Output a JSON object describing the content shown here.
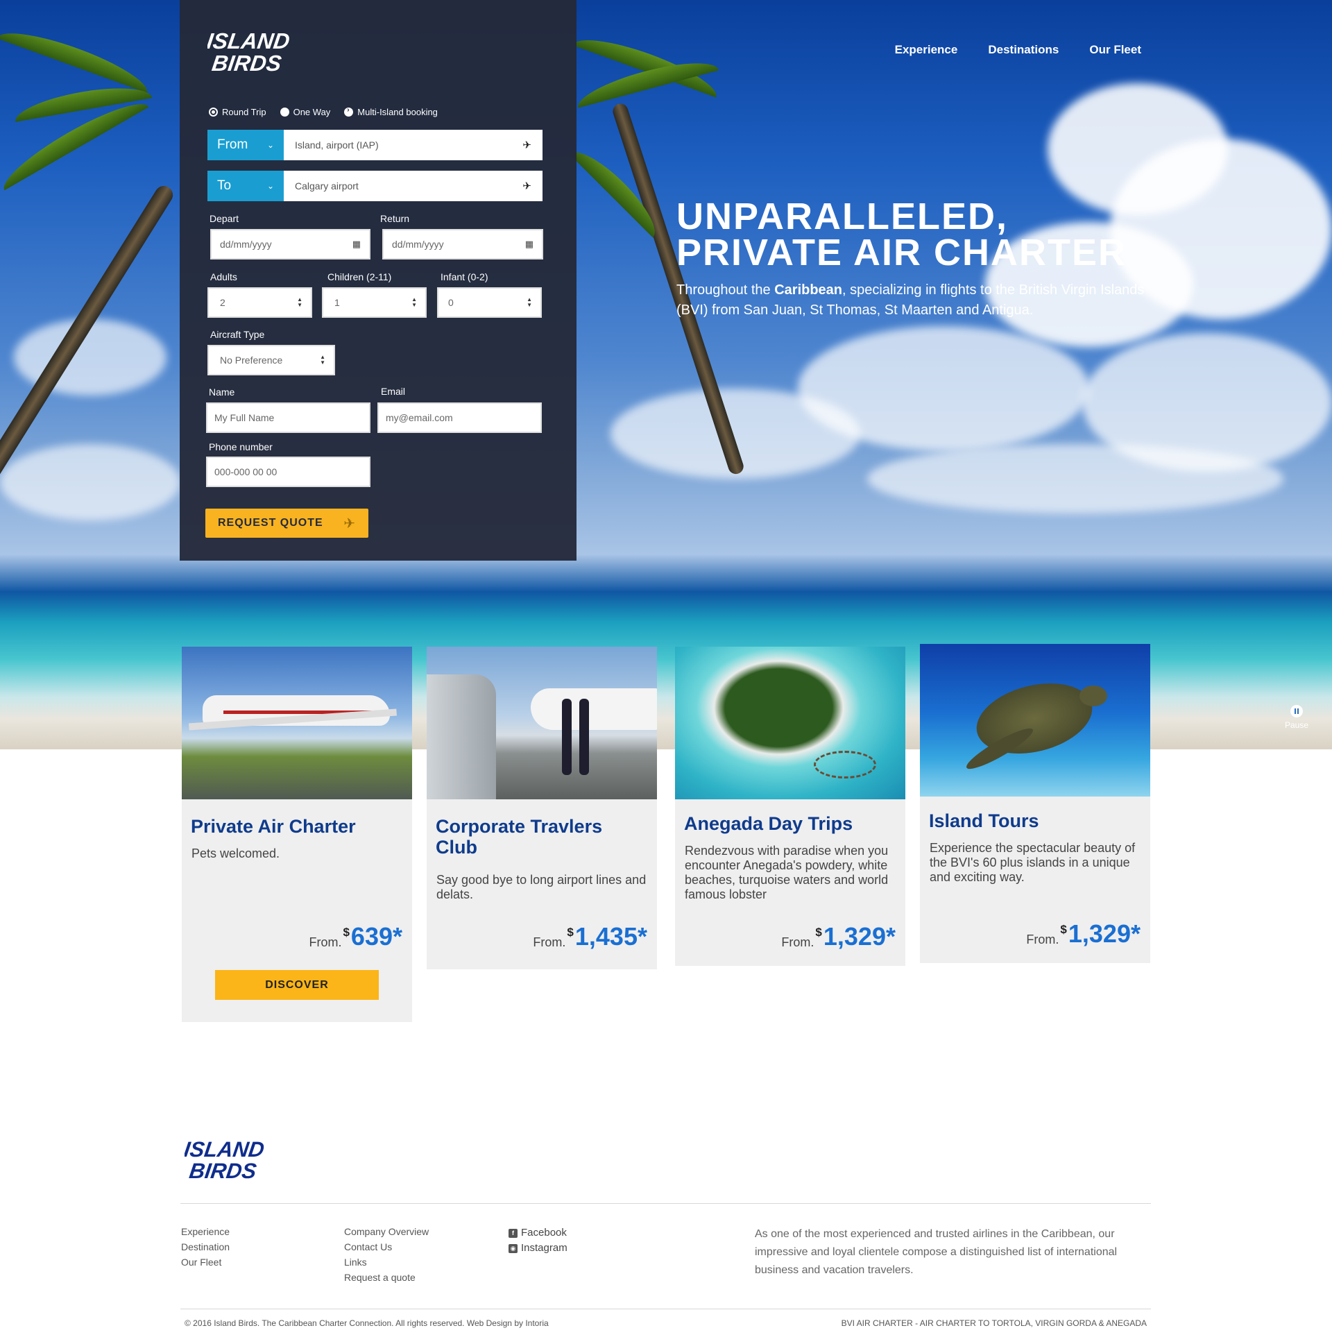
{
  "brand": {
    "line1": "ISLAND",
    "line2": "BIRDS",
    "footer_color": "#0f2d8c"
  },
  "nav": {
    "items": [
      "Experience",
      "Destinations",
      "Our Fleet"
    ]
  },
  "form": {
    "trip_types": [
      "Round Trip",
      "One Way",
      "Multi-Island booking"
    ],
    "from_label": "From",
    "from_value": "Island, airport (IAP)",
    "to_label": "To",
    "to_value": "Calgary airport",
    "depart_label": "Depart",
    "depart_placeholder": "dd/mm/yyyy",
    "return_label": "Return",
    "return_placeholder": "dd/mm/yyyy",
    "adults_label": "Adults",
    "adults_value": "2",
    "children_label": "Children (2-11)",
    "children_value": "1",
    "infant_label": "Infant (0-2)",
    "infant_value": "0",
    "aircraft_label": "Aircraft Type",
    "aircraft_value": "No Preference",
    "name_label": "Name",
    "name_placeholder": "My Full Name",
    "email_label": "Email",
    "email_placeholder": "my@email.com",
    "phone_label": "Phone number",
    "phone_placeholder": "000-000 00 00",
    "submit_label": "REQUEST QUOTE"
  },
  "hero": {
    "headline_1": "UNPARALLELED,",
    "headline_2": "PRIVATE AIR CHARTER",
    "sub_prefix": "Throughout the ",
    "sub_bold": "Caribbean",
    "sub_rest": ", specializing in flights to the British Virgin Islands (BVI) from San Juan, St Thomas, St Maarten and Antigua.",
    "pause_label": "Pause"
  },
  "cards": [
    {
      "title": "Private Air Charter",
      "text": "Pets welcomed.",
      "from": "From.",
      "currency": "$",
      "price": "639*",
      "button": "DISCOVER"
    },
    {
      "title": "Corporate Travlers Club",
      "text": "Say good bye to long airport lines and delats.",
      "from": "From.",
      "currency": "$",
      "price": "1,435*"
    },
    {
      "title": "Anegada Day Trips",
      "text": "Rendezvous with paradise when you encounter Anegada's powdery, white beaches, turquoise waters and world famous lobster",
      "from": "From.",
      "currency": "$",
      "price": "1,329*"
    },
    {
      "title": "Island Tours",
      "text": "Experience the spectacular beauty of the BVI's 60 plus islands in a unique and exciting way.",
      "from": "From.",
      "currency": "$",
      "price": "1,329*"
    }
  ],
  "footer": {
    "col1": [
      "Experience",
      "Destination",
      "Our Fleet"
    ],
    "col2": [
      "Company Overview",
      "Contact Us",
      "Links",
      "Request a quote"
    ],
    "social": [
      "Facebook",
      "Instagram"
    ],
    "about": "As one of the most experienced and trusted airlines in the Caribbean, our impressive and loyal clientele compose a distinguished list of international business and vacation travelers.",
    "copyright": "© 2016 Island Birds. The Caribbean Charter Connection. All rights reserved. Web Design by Intoria",
    "tagline": "BVI AIR CHARTER - AIR CHARTER TO TORTOLA, VIRGIN GORDA & ANEGADA"
  },
  "colors": {
    "accent_yellow": "#f9b320",
    "accent_blue": "#1a9ed1",
    "title_navy": "#0f3b8c",
    "price_blue": "#1a6fd2",
    "panel": "#242a3a"
  }
}
